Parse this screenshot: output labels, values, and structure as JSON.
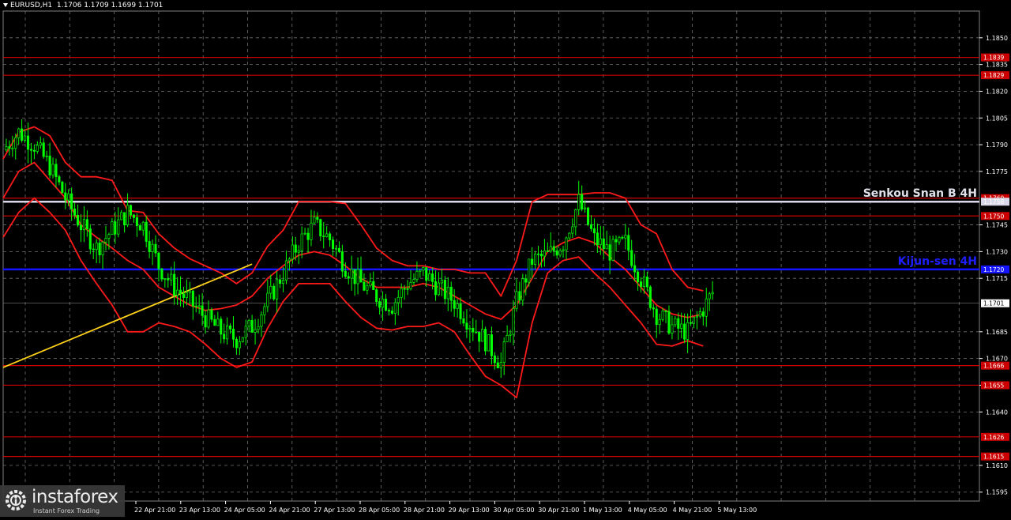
{
  "header": {
    "symbol": "EURUSD,H1",
    "ohlc": "1.1706 1.1709 1.1699 1.1701"
  },
  "colors": {
    "background": "#000000",
    "grid": "#707070",
    "bull": "#00ff00",
    "bear": "#00ff00",
    "levels": "#cc0000",
    "ichimoku_band": "#ff1a1a",
    "kijun": "#1414ff",
    "senkou": "#d8d8e8",
    "trendline": "#ffd21a",
    "axis_text": "#ffffff"
  },
  "logo": {
    "brand": "instaforex",
    "tagline": "Instant Forex Trading",
    "icon": "gear-logo-icon"
  },
  "chart_data": {
    "type": "candlestick",
    "symbol": "EURUSD",
    "timeframe": "H1",
    "ylim": [
      1.159,
      1.1865
    ],
    "grid": true,
    "y_ticks": [
      "1.1850",
      "1.1835",
      "1.1820",
      "1.1805",
      "1.1790",
      "1.1775",
      "1.1745",
      "1.1730",
      "1.1715",
      "1.1685",
      "1.1670",
      "1.1655",
      "1.1640",
      "1.1610",
      "1.1595"
    ],
    "x_ticks": [
      "22 Apr 21:00",
      "23 Apr 13:00",
      "24 Apr 05:00",
      "24 Apr 21:00",
      "27 Apr 13:00",
      "28 Apr 05:00",
      "28 Apr 21:00",
      "29 Apr 13:00",
      "30 Apr 05:00",
      "30 Apr 21:00",
      "1 May 13:00",
      "4 May 05:00",
      "4 May 21:00",
      "5 May 13:00"
    ],
    "levels": [
      {
        "value": 1.1839,
        "label": "1.1839",
        "color": "#cc0000"
      },
      {
        "value": 1.1829,
        "label": "1.1829",
        "color": "#cc0000"
      },
      {
        "value": 1.176,
        "label": "1.1760",
        "color": "#cc0000"
      },
      {
        "value": 1.1758,
        "label": "1.1758",
        "color": "#d8d8e8",
        "name": "Senkou Snan B 4H"
      },
      {
        "value": 1.175,
        "label": "1.1750",
        "color": "#cc0000"
      },
      {
        "value": 1.172,
        "label": "1.1720",
        "color": "#1414ff",
        "name": "Kijun-sen 4H"
      },
      {
        "value": 1.1701,
        "label": "1.1701",
        "color": "#ffffff",
        "current": true
      },
      {
        "value": 1.1666,
        "label": "1.1666",
        "color": "#cc0000"
      },
      {
        "value": 1.1655,
        "label": "1.1655",
        "color": "#cc0000"
      },
      {
        "value": 1.1626,
        "label": "1.1626",
        "color": "#cc0000"
      },
      {
        "value": 1.1615,
        "label": "1.1615",
        "color": "#cc0000"
      }
    ],
    "trendline": {
      "from": [
        0,
        1.1665
      ],
      "to": [
        80,
        1.1723
      ]
    },
    "close_path": [
      [
        0,
        1.1787
      ],
      [
        5,
        1.1797
      ],
      [
        10,
        1.179
      ],
      [
        15,
        1.1778
      ],
      [
        20,
        1.176
      ],
      [
        25,
        1.1745
      ],
      [
        30,
        1.1732
      ],
      [
        35,
        1.1742
      ],
      [
        40,
        1.1752
      ],
      [
        45,
        1.1745
      ],
      [
        50,
        1.1722
      ],
      [
        55,
        1.171
      ],
      [
        60,
        1.1702
      ],
      [
        65,
        1.1693
      ],
      [
        70,
        1.1685
      ],
      [
        75,
        1.1681
      ],
      [
        80,
        1.1688
      ],
      [
        85,
        1.1702
      ],
      [
        90,
        1.1718
      ],
      [
        95,
        1.1735
      ],
      [
        100,
        1.1745
      ],
      [
        105,
        1.1737
      ],
      [
        110,
        1.1722
      ],
      [
        115,
        1.1712
      ],
      [
        120,
        1.1705
      ],
      [
        125,
        1.17
      ],
      [
        130,
        1.1712
      ],
      [
        135,
        1.1718
      ],
      [
        140,
        1.171
      ],
      [
        145,
        1.1702
      ],
      [
        150,
        1.169
      ],
      [
        155,
        1.168
      ],
      [
        160,
        1.1667
      ],
      [
        165,
        1.1702
      ],
      [
        170,
        1.1725
      ],
      [
        175,
        1.1728
      ],
      [
        180,
        1.1735
      ],
      [
        185,
        1.1758
      ],
      [
        190,
        1.1737
      ],
      [
        195,
        1.173
      ],
      [
        200,
        1.1735
      ],
      [
        205,
        1.1715
      ],
      [
        210,
        1.1695
      ],
      [
        215,
        1.1688
      ],
      [
        220,
        1.1685
      ],
      [
        225,
        1.1698
      ],
      [
        228,
        1.1707
      ]
    ],
    "ichimoku_upper": [
      [
        0,
        1.1782
      ],
      [
        5,
        1.1797
      ],
      [
        10,
        1.18
      ],
      [
        15,
        1.1795
      ],
      [
        20,
        1.178
      ],
      [
        25,
        1.1772
      ],
      [
        30,
        1.1772
      ],
      [
        35,
        1.177
      ],
      [
        40,
        1.1753
      ],
      [
        45,
        1.1752
      ],
      [
        50,
        1.174
      ],
      [
        55,
        1.1732
      ],
      [
        60,
        1.1726
      ],
      [
        65,
        1.1722
      ],
      [
        70,
        1.1718
      ],
      [
        75,
        1.1712
      ],
      [
        80,
        1.1718
      ],
      [
        85,
        1.1733
      ],
      [
        90,
        1.1742
      ],
      [
        95,
        1.1758
      ],
      [
        100,
        1.1758
      ],
      [
        105,
        1.1758
      ],
      [
        110,
        1.1757
      ],
      [
        115,
        1.1745
      ],
      [
        120,
        1.1732
      ],
      [
        125,
        1.1725
      ],
      [
        130,
        1.1722
      ],
      [
        135,
        1.1722
      ],
      [
        140,
        1.172
      ],
      [
        145,
        1.172
      ],
      [
        150,
        1.1718
      ],
      [
        155,
        1.1718
      ],
      [
        160,
        1.1705
      ],
      [
        165,
        1.1725
      ],
      [
        170,
        1.1758
      ],
      [
        175,
        1.1762
      ],
      [
        180,
        1.1762
      ],
      [
        185,
        1.1762
      ],
      [
        190,
        1.1763
      ],
      [
        195,
        1.1763
      ],
      [
        200,
        1.176
      ],
      [
        205,
        1.1745
      ],
      [
        210,
        1.174
      ],
      [
        215,
        1.172
      ],
      [
        220,
        1.171
      ],
      [
        225,
        1.1708
      ]
    ],
    "ichimoku_mid": [
      [
        0,
        1.176
      ],
      [
        5,
        1.1775
      ],
      [
        10,
        1.178
      ],
      [
        15,
        1.177
      ],
      [
        20,
        1.176
      ],
      [
        25,
        1.1745
      ],
      [
        30,
        1.1738
      ],
      [
        35,
        1.1732
      ],
      [
        40,
        1.1725
      ],
      [
        45,
        1.172
      ],
      [
        50,
        1.171
      ],
      [
        55,
        1.1705
      ],
      [
        60,
        1.17
      ],
      [
        65,
        1.1697
      ],
      [
        70,
        1.1698
      ],
      [
        75,
        1.17
      ],
      [
        80,
        1.1705
      ],
      [
        85,
        1.1715
      ],
      [
        90,
        1.1722
      ],
      [
        95,
        1.1728
      ],
      [
        100,
        1.173
      ],
      [
        105,
        1.1728
      ],
      [
        110,
        1.1722
      ],
      [
        115,
        1.1715
      ],
      [
        120,
        1.171
      ],
      [
        125,
        1.171
      ],
      [
        130,
        1.171
      ],
      [
        135,
        1.1712
      ],
      [
        140,
        1.171
      ],
      [
        145,
        1.1705
      ],
      [
        150,
        1.17
      ],
      [
        155,
        1.1695
      ],
      [
        160,
        1.1692
      ],
      [
        165,
        1.17
      ],
      [
        170,
        1.1715
      ],
      [
        175,
        1.173
      ],
      [
        180,
        1.1735
      ],
      [
        185,
        1.1738
      ],
      [
        190,
        1.1735
      ],
      [
        195,
        1.1727
      ],
      [
        200,
        1.172
      ],
      [
        205,
        1.171
      ],
      [
        210,
        1.17
      ],
      [
        215,
        1.1695
      ],
      [
        220,
        1.1693
      ],
      [
        225,
        1.1695
      ]
    ],
    "ichimoku_lower": [
      [
        0,
        1.1738
      ],
      [
        5,
        1.1752
      ],
      [
        10,
        1.176
      ],
      [
        15,
        1.1752
      ],
      [
        20,
        1.1742
      ],
      [
        25,
        1.1725
      ],
      [
        30,
        1.1712
      ],
      [
        35,
        1.17
      ],
      [
        40,
        1.1685
      ],
      [
        45,
        1.1685
      ],
      [
        50,
        1.169
      ],
      [
        55,
        1.1688
      ],
      [
        60,
        1.1685
      ],
      [
        65,
        1.1678
      ],
      [
        70,
        1.167
      ],
      [
        75,
        1.1665
      ],
      [
        80,
        1.1668
      ],
      [
        85,
        1.1687
      ],
      [
        90,
        1.1702
      ],
      [
        95,
        1.1712
      ],
      [
        100,
        1.1712
      ],
      [
        105,
        1.1712
      ],
      [
        110,
        1.1702
      ],
      [
        115,
        1.1693
      ],
      [
        120,
        1.1687
      ],
      [
        125,
        1.1686
      ],
      [
        130,
        1.1688
      ],
      [
        135,
        1.1688
      ],
      [
        140,
        1.169
      ],
      [
        145,
        1.1685
      ],
      [
        150,
        1.1672
      ],
      [
        155,
        1.166
      ],
      [
        160,
        1.1655
      ],
      [
        165,
        1.1648
      ],
      [
        170,
        1.169
      ],
      [
        175,
        1.1718
      ],
      [
        180,
        1.1725
      ],
      [
        185,
        1.1727
      ],
      [
        190,
        1.1718
      ],
      [
        195,
        1.171
      ],
      [
        200,
        1.17
      ],
      [
        205,
        1.169
      ],
      [
        210,
        1.1678
      ],
      [
        215,
        1.1677
      ],
      [
        220,
        1.168
      ],
      [
        225,
        1.1677
      ]
    ]
  }
}
